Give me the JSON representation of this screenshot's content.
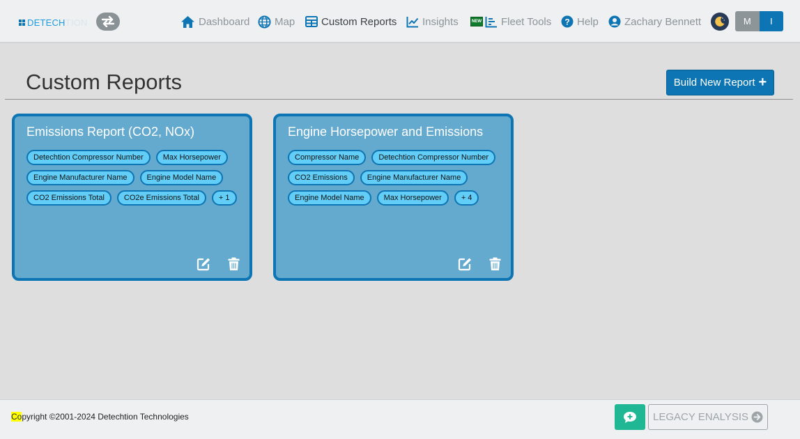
{
  "brand": {
    "logo_primary": "DETECH",
    "logo_secondary": "TION"
  },
  "nav": {
    "dashboard": "Dashboard",
    "map": "Map",
    "custom_reports": "Custom Reports",
    "insights": "Insights",
    "new_badge": "NEW",
    "fleet_tools": "Fleet Tools",
    "help": "Help",
    "user": "Zachary Bennett",
    "toggle_m": "M",
    "toggle_i": "I"
  },
  "page": {
    "title": "Custom Reports",
    "build_button": "Build New Report",
    "build_button_icon": "+"
  },
  "reports": [
    {
      "title": "Emissions Report (CO2, NOx)",
      "tags": [
        "Detechtion Compressor Number",
        "Max Horsepower",
        "Engine Manufacturer Name",
        "Engine Model Name",
        "CO2 Emissions Total",
        "CO2e Emissions Total",
        "+ 1"
      ]
    },
    {
      "title": "Engine Horsepower and Emissions",
      "tags": [
        "Compressor Name",
        "Detechtion Compressor Number",
        "CO2 Emissions",
        "Engine Manufacturer Name",
        "Engine Model Name",
        "Max Horsepower",
        "+ 4"
      ]
    }
  ],
  "footer": {
    "copyright_highlight": "Co",
    "copyright_rest": "pyright ©2001-2024 Detechtion Technologies",
    "legacy_button": "LEGACY ENALYSIS"
  },
  "colors": {
    "primary": "#0d75b3",
    "card_bg": "#64a9ce",
    "chip_bg": "#62cdf7",
    "chat": "#20b795"
  },
  "icons": [
    "home-icon",
    "globe-icon",
    "table-icon",
    "chart-line-icon",
    "fleet-tools-icon",
    "help-icon",
    "user-icon",
    "moon-icon",
    "swap-icon",
    "edit-icon",
    "trash-icon",
    "chat-plus-icon",
    "arrow-right-circle-icon"
  ]
}
